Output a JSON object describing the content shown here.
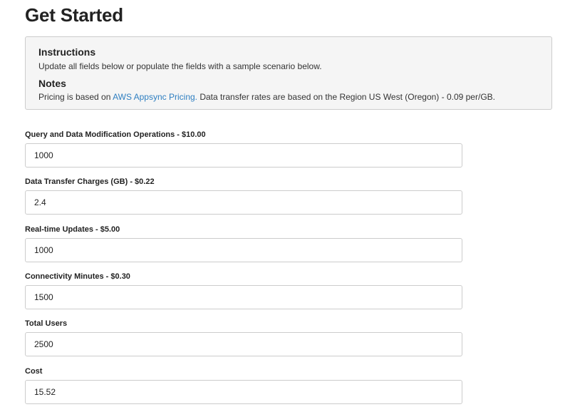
{
  "page": {
    "title": "Get Started"
  },
  "info": {
    "instructions_heading": "Instructions",
    "instructions_text": "Update all fields below or populate the fields with a sample scenario below.",
    "notes_heading": "Notes",
    "notes_prefix": "Pricing is based on ",
    "notes_link": "AWS Appsync Pricing.",
    "notes_suffix": " Data transfer rates are based on the Region US West (Oregon) - 0.09 per/GB.",
    "link_color": "#2f7fc1"
  },
  "fields": [
    {
      "label": "Query and Data Modification Operations - $10.00",
      "value": "1000"
    },
    {
      "label": "Data Transfer Charges (GB) - $0.22",
      "value": "2.4"
    },
    {
      "label": "Real-time Updates - $5.00",
      "value": "1000"
    },
    {
      "label": "Connectivity Minutes - $0.30",
      "value": "1500"
    },
    {
      "label": "Total Users",
      "value": "2500"
    },
    {
      "label": "Cost",
      "value": "15.52"
    }
  ]
}
